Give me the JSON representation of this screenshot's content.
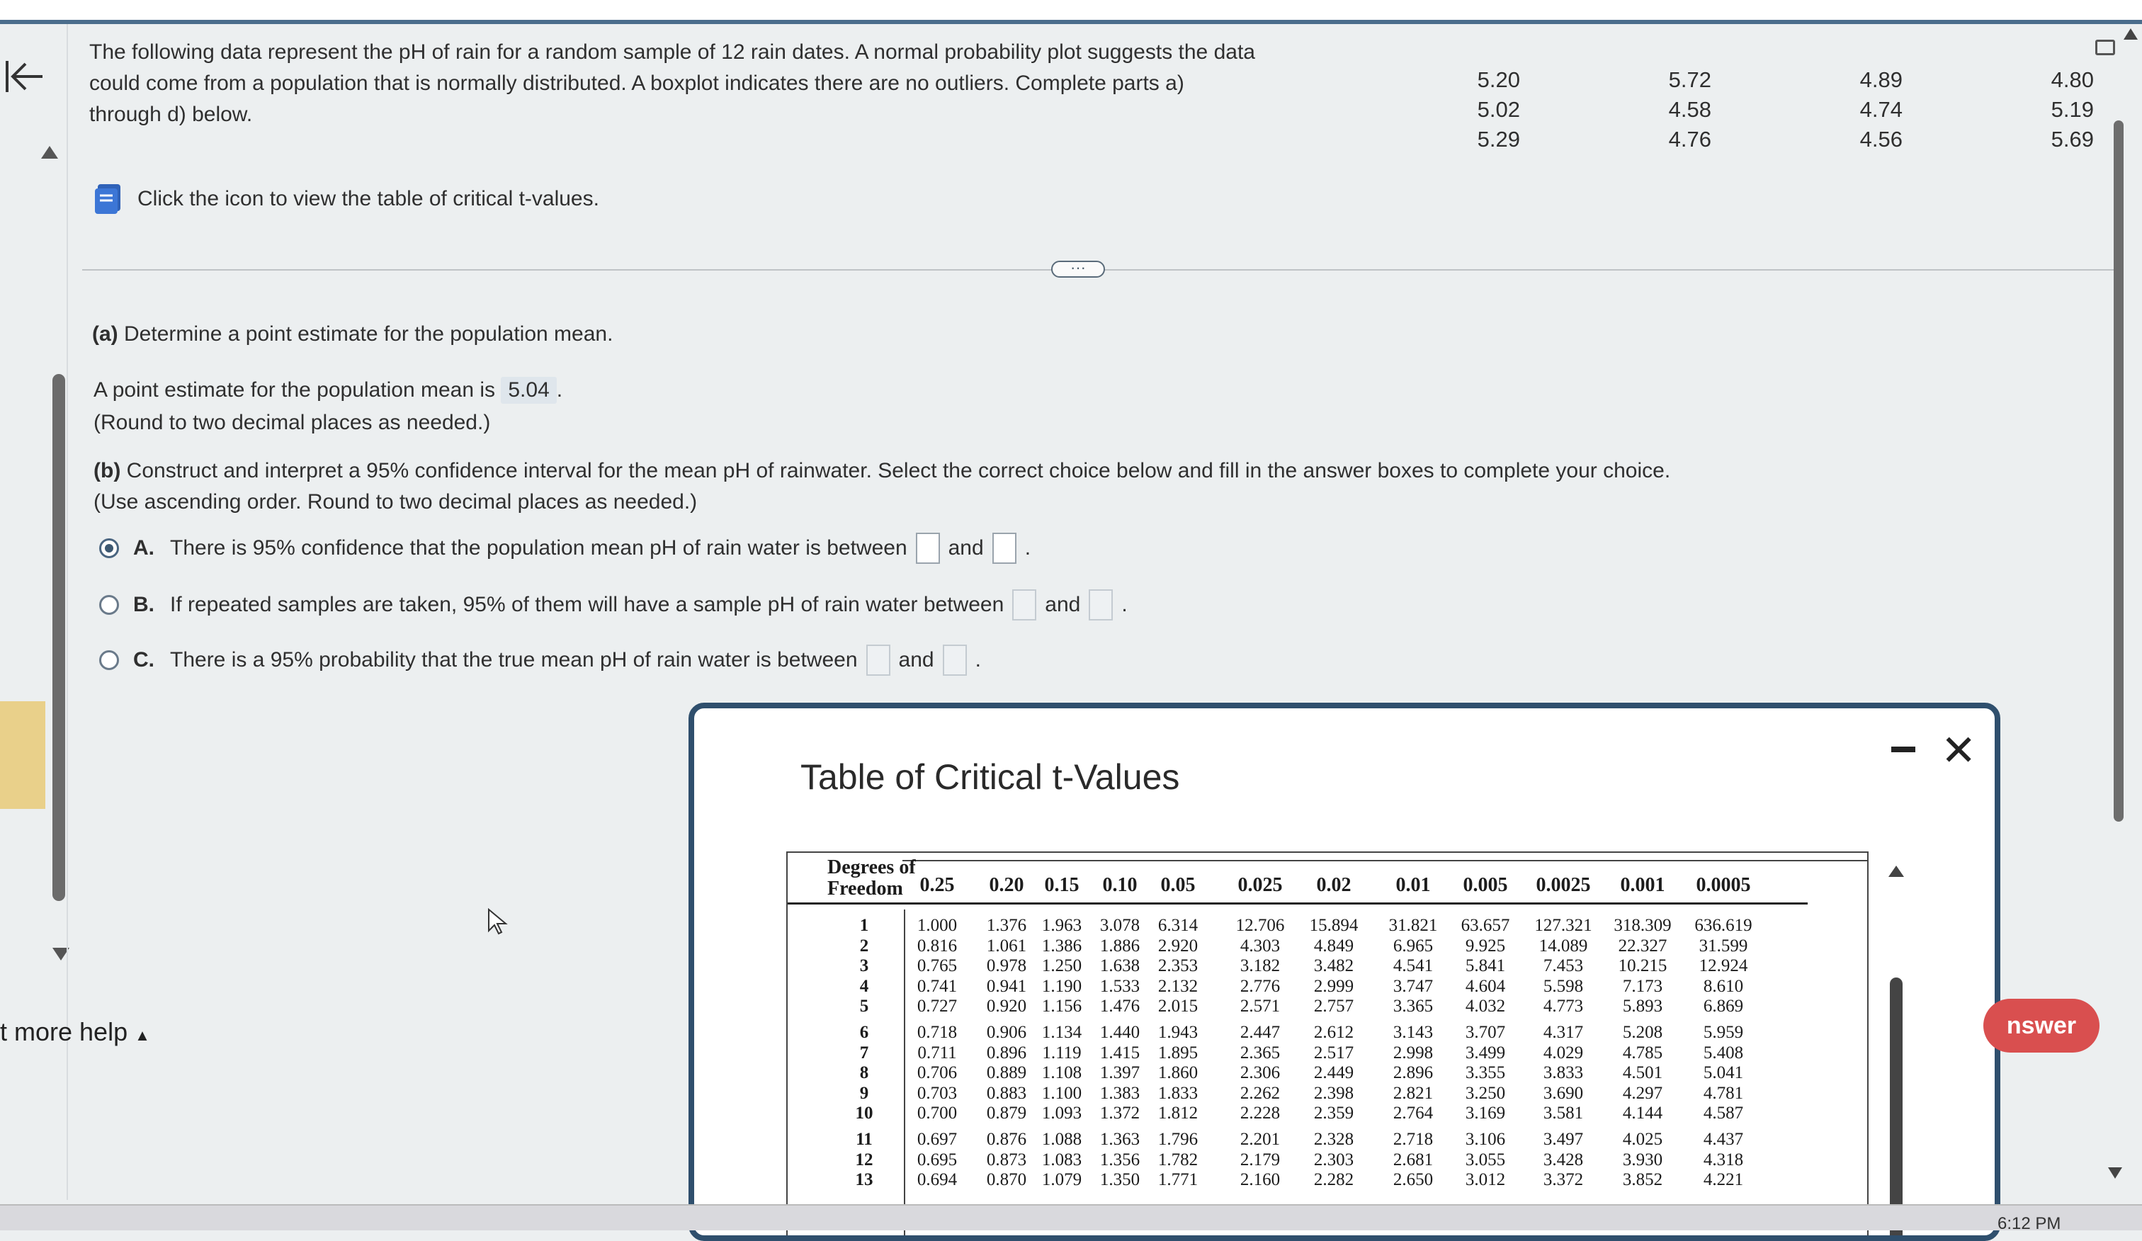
{
  "intro": {
    "lines": [
      "The following data represent the pH of rain for a random sample of 12 rain dates. A normal probability plot suggests the data",
      "could come from a population that is normally distributed. A boxplot indicates there are no outliers. Complete parts a)",
      "through d) below."
    ]
  },
  "data_columns": [
    [
      "5.20",
      "5.02",
      "5.29"
    ],
    [
      "5.72",
      "4.58",
      "4.76"
    ],
    [
      "4.89",
      "4.74",
      "4.56"
    ],
    [
      "4.80",
      "5.19",
      "5.69"
    ]
  ],
  "table_link_text": "Click the icon to view the table of critical t-values.",
  "part_a": {
    "label": "(a)",
    "question": "Determine a point estimate for the population mean.",
    "answer_prefix": "A point estimate for the population mean is",
    "answer_value": "5.04",
    "answer_suffix": ".",
    "note": "(Round to two decimal places as needed.)"
  },
  "part_b": {
    "label": "(b)",
    "question": "Construct and interpret a 95% confidence interval for the mean pH of rainwater. Select the correct choice below and fill in the answer boxes to complete your choice.",
    "note": "(Use ascending order. Round to two decimal places as needed.)",
    "choices": [
      {
        "letter": "A.",
        "text": "There is 95% confidence that the population mean pH of rain water is between",
        "and": "and",
        "end": ".",
        "selected": true
      },
      {
        "letter": "B.",
        "text": "If repeated samples are taken, 95% of them will have a sample pH of rain water between",
        "and": "and",
        "end": ".",
        "selected": false
      },
      {
        "letter": "C.",
        "text": "There is a 95% probability that the true mean pH of rain water is between",
        "and": "and",
        "end": ".",
        "selected": false
      }
    ]
  },
  "more_help": "t more help",
  "answer_button": "nswer",
  "clock": "6:12 PM",
  "modal": {
    "title": "Table of Critical t-Values",
    "df_label_line1": "Degrees of",
    "df_label_line2": "Freedom",
    "probabilities": [
      "0.25",
      "0.20",
      "0.15",
      "0.10",
      "0.05",
      "0.025",
      "0.02",
      "0.01",
      "0.005",
      "0.0025",
      "0.001",
      "0.0005"
    ],
    "rows": [
      {
        "df": "1",
        "values": [
          "1.000",
          "1.376",
          "1.963",
          "3.078",
          "6.314",
          "12.706",
          "15.894",
          "31.821",
          "63.657",
          "127.321",
          "318.309",
          "636.619"
        ]
      },
      {
        "df": "2",
        "values": [
          "0.816",
          "1.061",
          "1.386",
          "1.886",
          "2.920",
          "4.303",
          "4.849",
          "6.965",
          "9.925",
          "14.089",
          "22.327",
          "31.599"
        ]
      },
      {
        "df": "3",
        "values": [
          "0.765",
          "0.978",
          "1.250",
          "1.638",
          "2.353",
          "3.182",
          "3.482",
          "4.541",
          "5.841",
          "7.453",
          "10.215",
          "12.924"
        ]
      },
      {
        "df": "4",
        "values": [
          "0.741",
          "0.941",
          "1.190",
          "1.533",
          "2.132",
          "2.776",
          "2.999",
          "3.747",
          "4.604",
          "5.598",
          "7.173",
          "8.610"
        ]
      },
      {
        "df": "5",
        "values": [
          "0.727",
          "0.920",
          "1.156",
          "1.476",
          "2.015",
          "2.571",
          "2.757",
          "3.365",
          "4.032",
          "4.773",
          "5.893",
          "6.869"
        ]
      },
      {
        "df": "6",
        "values": [
          "0.718",
          "0.906",
          "1.134",
          "1.440",
          "1.943",
          "2.447",
          "2.612",
          "3.143",
          "3.707",
          "4.317",
          "5.208",
          "5.959"
        ]
      },
      {
        "df": "7",
        "values": [
          "0.711",
          "0.896",
          "1.119",
          "1.415",
          "1.895",
          "2.365",
          "2.517",
          "2.998",
          "3.499",
          "4.029",
          "4.785",
          "5.408"
        ]
      },
      {
        "df": "8",
        "values": [
          "0.706",
          "0.889",
          "1.108",
          "1.397",
          "1.860",
          "2.306",
          "2.449",
          "2.896",
          "3.355",
          "3.833",
          "4.501",
          "5.041"
        ]
      },
      {
        "df": "9",
        "values": [
          "0.703",
          "0.883",
          "1.100",
          "1.383",
          "1.833",
          "2.262",
          "2.398",
          "2.821",
          "3.250",
          "3.690",
          "4.297",
          "4.781"
        ]
      },
      {
        "df": "10",
        "values": [
          "0.700",
          "0.879",
          "1.093",
          "1.372",
          "1.812",
          "2.228",
          "2.359",
          "2.764",
          "3.169",
          "3.581",
          "4.144",
          "4.587"
        ]
      },
      {
        "df": "11",
        "values": [
          "0.697",
          "0.876",
          "1.088",
          "1.363",
          "1.796",
          "2.201",
          "2.328",
          "2.718",
          "3.106",
          "3.497",
          "4.025",
          "4.437"
        ]
      },
      {
        "df": "12",
        "values": [
          "0.695",
          "0.873",
          "1.083",
          "1.356",
          "1.782",
          "2.179",
          "2.303",
          "2.681",
          "3.055",
          "3.428",
          "3.930",
          "4.318"
        ]
      },
      {
        "df": "13",
        "values": [
          "0.694",
          "0.870",
          "1.079",
          "1.350",
          "1.771",
          "2.160",
          "2.282",
          "2.650",
          "3.012",
          "3.372",
          "3.852",
          "4.221"
        ]
      }
    ]
  }
}
